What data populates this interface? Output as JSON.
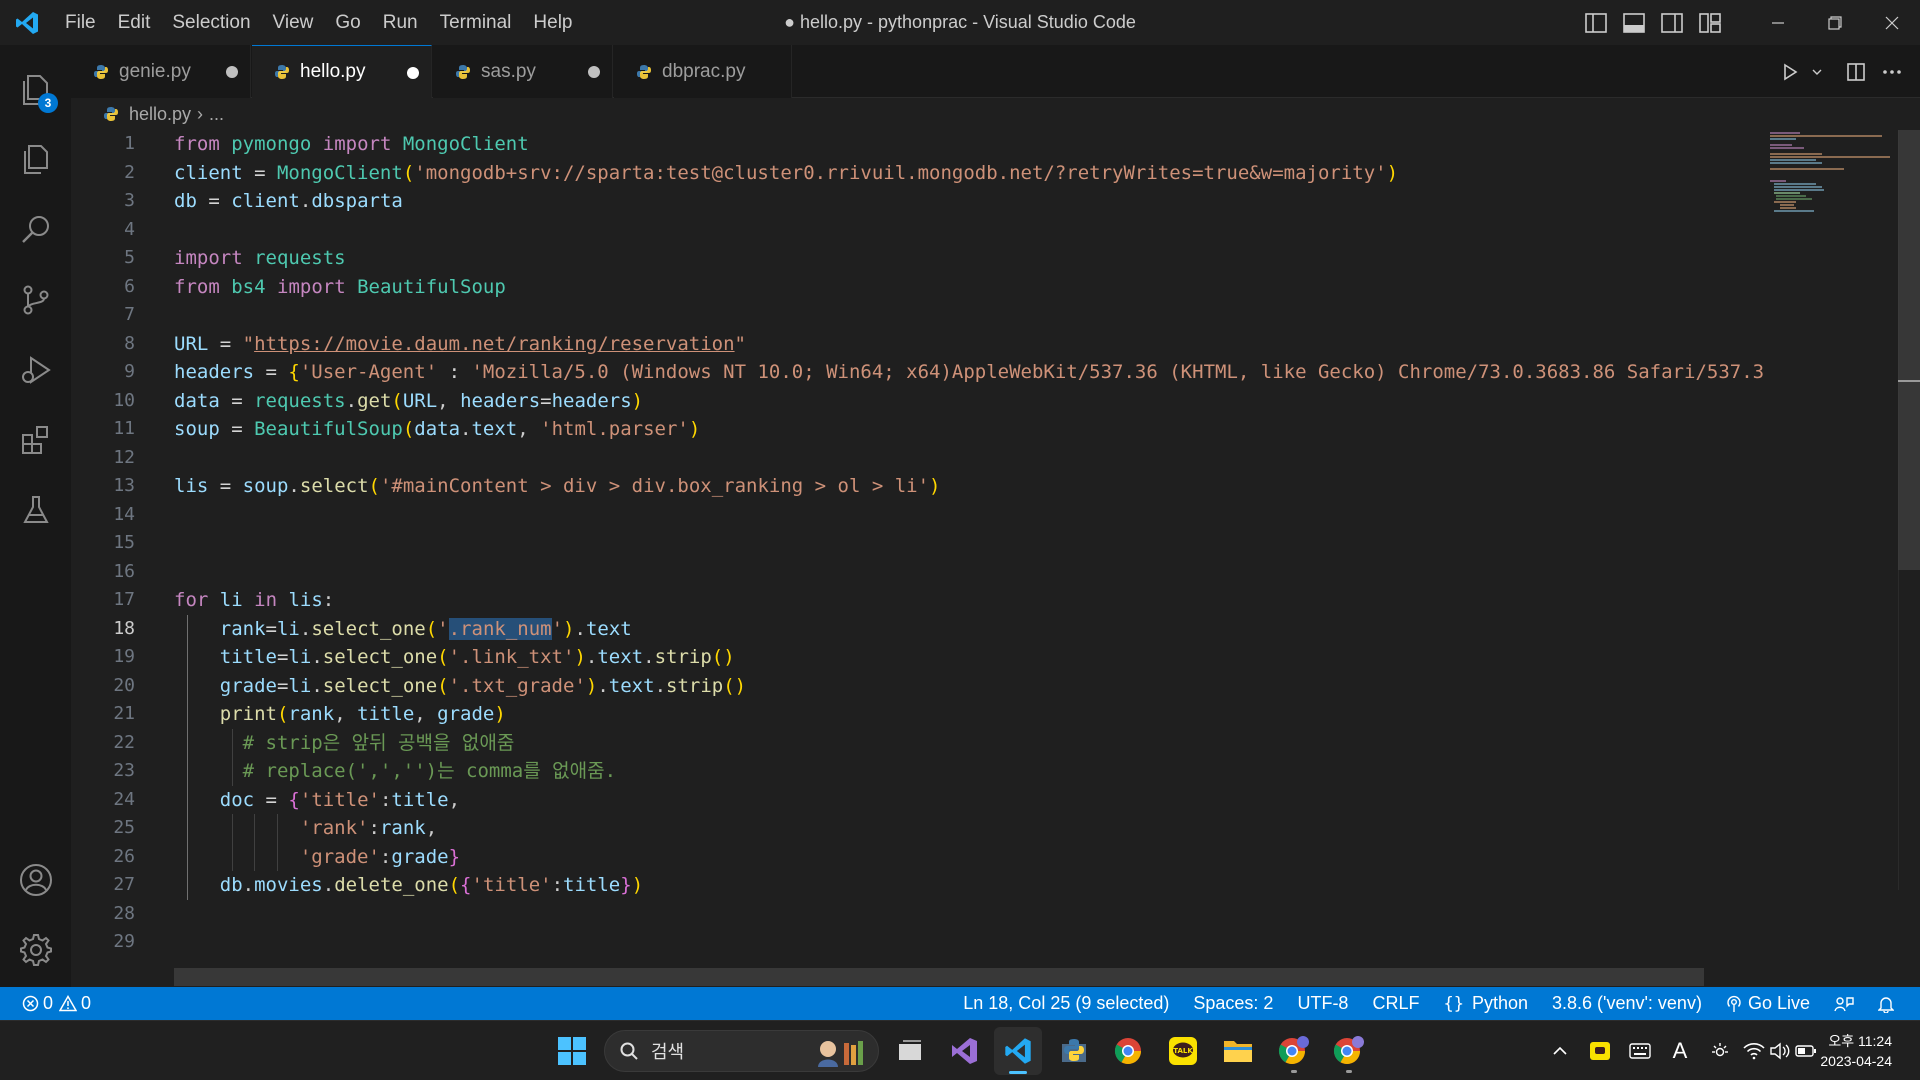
{
  "window": {
    "title": "● hello.py - pythonprac - Visual Studio Code"
  },
  "menu": [
    "File",
    "Edit",
    "Selection",
    "View",
    "Go",
    "Run",
    "Terminal",
    "Help"
  ],
  "activity": {
    "explorer_badge": "3"
  },
  "tabs": [
    {
      "label": "genie.py",
      "modified": true,
      "active": false
    },
    {
      "label": "hello.py",
      "modified": true,
      "active": true
    },
    {
      "label": "sas.py",
      "modified": true,
      "active": false
    },
    {
      "label": "dbprac.py",
      "modified": false,
      "active": false
    }
  ],
  "breadcrumb": {
    "file": "hello.py",
    "sep": "›",
    "more": "..."
  },
  "editor": {
    "current_line": 18,
    "line_numbers": [
      "1",
      "2",
      "3",
      "4",
      "5",
      "6",
      "7",
      "8",
      "9",
      "10",
      "11",
      "12",
      "13",
      "14",
      "15",
      "16",
      "17",
      "18",
      "19",
      "20",
      "21",
      "22",
      "23",
      "24",
      "25",
      "26",
      "27",
      "28",
      "29"
    ],
    "code": {
      "l1": [
        "from",
        " ",
        "pymongo",
        " ",
        "import",
        " ",
        "MongoClient"
      ],
      "l2": [
        "client",
        " = ",
        "MongoClient",
        "(",
        "'mongodb+srv://sparta:test@cluster0.rrivuil.mongodb.net/?retryWrites=true&w=majority'",
        ")"
      ],
      "l3": [
        "db",
        " = ",
        "client",
        ".",
        "dbsparta"
      ],
      "l5": [
        "import",
        " ",
        "requests"
      ],
      "l6": [
        "from",
        " ",
        "bs4",
        " ",
        "import",
        " ",
        "BeautifulSoup"
      ],
      "l8": [
        "URL",
        " = ",
        "\"",
        "https://movie.daum.net/ranking/reservation",
        "\""
      ],
      "l9": [
        "headers",
        " = ",
        "{",
        "'User-Agent'",
        " : ",
        "'Mozilla/5.0 (Windows NT 10.0; Win64; x64)AppleWebKit/537.36 (KHTML, like Gecko) Chrome/73.0.3683.86 Safari/537.3"
      ],
      "l10": [
        "data",
        " = ",
        "requests",
        ".",
        "get",
        "(",
        "URL",
        ", ",
        "headers",
        "=",
        "headers",
        ")"
      ],
      "l11": [
        "soup",
        " = ",
        "BeautifulSoup",
        "(",
        "data",
        ".",
        "text",
        ", ",
        "'html.parser'",
        ")"
      ],
      "l13": [
        "lis",
        " = ",
        "soup",
        ".",
        "select",
        "(",
        "'#mainContent > div > div.box_ranking > ol > li'",
        ")"
      ],
      "l17": [
        "for",
        " ",
        "li",
        " ",
        "in",
        " ",
        "lis",
        ":"
      ],
      "l18": [
        "rank",
        "=",
        "li",
        ".",
        "select_one",
        "(",
        "'",
        ".rank_num",
        "'",
        ")",
        ".",
        "text"
      ],
      "l19": [
        "title",
        "=",
        "li",
        ".",
        "select_one",
        "(",
        "'.link_txt'",
        ")",
        ".",
        "text",
        ".",
        "strip",
        "()"
      ],
      "l20": [
        "grade",
        "=",
        "li",
        ".",
        "select_one",
        "(",
        "'.txt_grade'",
        ")",
        ".",
        "text",
        ".",
        "strip",
        "()"
      ],
      "l21": [
        "print",
        "(",
        "rank",
        ", ",
        "title",
        ", ",
        "grade",
        ")"
      ],
      "l22": "# strip은 앞뒤 공백을 없애줌",
      "l23": "# replace(',','')는 comma를 없애줌.",
      "l24": [
        "doc",
        " = ",
        "{",
        "'title'",
        ":",
        "title",
        ","
      ],
      "l25": [
        "'rank'",
        ":",
        "rank",
        ","
      ],
      "l26": [
        "'grade'",
        ":",
        "grade",
        "}"
      ],
      "l27": [
        "db",
        ".",
        "movies",
        ".",
        "delete_one",
        "(",
        "{",
        "'title'",
        ":",
        "title",
        "}",
        ")"
      ]
    }
  },
  "statusbar": {
    "errors": "0",
    "warnings": "0",
    "position": "Ln 18, Col 25 (9 selected)",
    "spaces": "Spaces: 2",
    "encoding": "UTF-8",
    "eol": "CRLF",
    "language": "Python",
    "interpreter": "3.8.6 ('venv': venv)",
    "golive": "Go Live"
  },
  "taskbar": {
    "search_placeholder": "검색",
    "time": "오후 11:24",
    "date": "2023-04-24",
    "ime": "A"
  },
  "colors": {
    "accent": "#0078d4",
    "keyword": "#c586c0",
    "string": "#ce9178",
    "comment": "#6a9955"
  }
}
